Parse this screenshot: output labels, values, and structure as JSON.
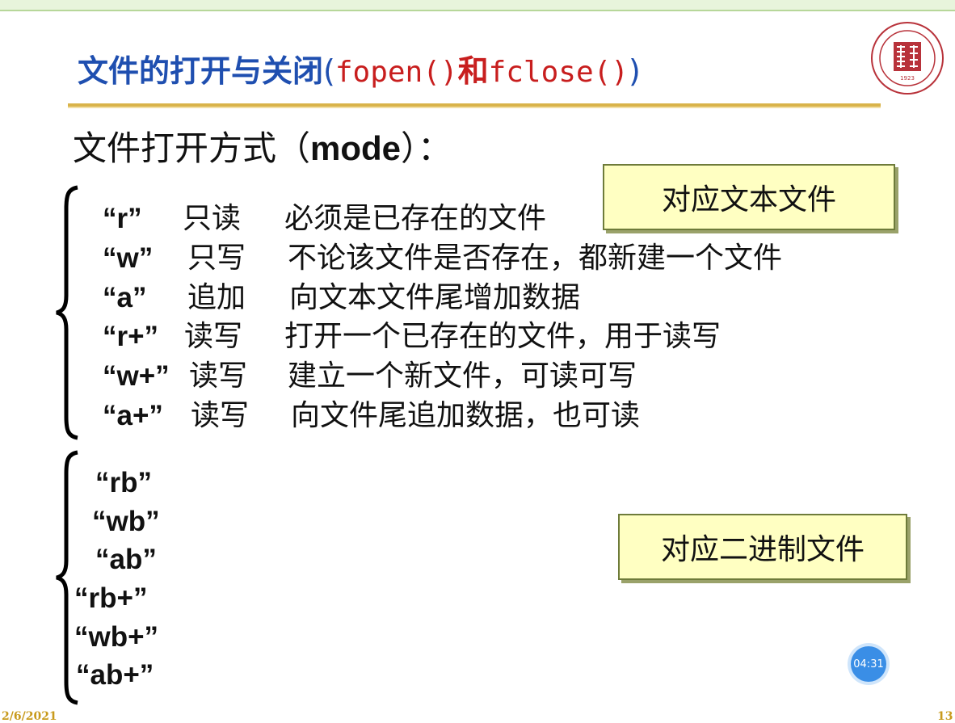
{
  "slide": {
    "title_cn": "文件的打开与关闭",
    "title_paren_open": "(",
    "title_code1": "fopen()",
    "title_he": "和",
    "title_code2": "fclose()",
    "title_paren_close": ")",
    "heading_cn": "文件打开方式（",
    "heading_mode": "mode",
    "heading_end": "）：",
    "text_box_label": "对应文本文件",
    "binary_box_label": "对应二进制文件",
    "text_modes": [
      {
        "code": "“r”",
        "op": "只读",
        "desc": "必须是已存在的文件"
      },
      {
        "code": "“w”",
        "op": "只写",
        "desc": "不论该文件是否存在，都新建一个文件"
      },
      {
        "code": "“a”",
        "op": "追加",
        "desc": "向文本文件尾增加数据"
      },
      {
        "code": "“r+”",
        "op": "读写",
        "desc": "打开一个已存在的文件，用于读写"
      },
      {
        "code": "“w+”",
        "op": "读写",
        "desc": "建立一个新文件，可读可写"
      },
      {
        "code": "“a+”",
        "op": "读写",
        "desc": "向文件尾追加数据，也可读"
      }
    ],
    "binary_modes": [
      "“rb”",
      "“wb”",
      "“ab”",
      "“rb+”",
      "“wb+”",
      "“ab+”"
    ],
    "date": "2/6/2021",
    "page_number": "13",
    "logo_year": "1923"
  },
  "overlay": {
    "timer": "04:31"
  },
  "colors": {
    "title_blue": "#1f4fb0",
    "title_red": "#c81e1e",
    "rule_gold": "#d9b34a",
    "box_fill": "#ffffc2",
    "timer_blue": "#3a8ee6"
  }
}
